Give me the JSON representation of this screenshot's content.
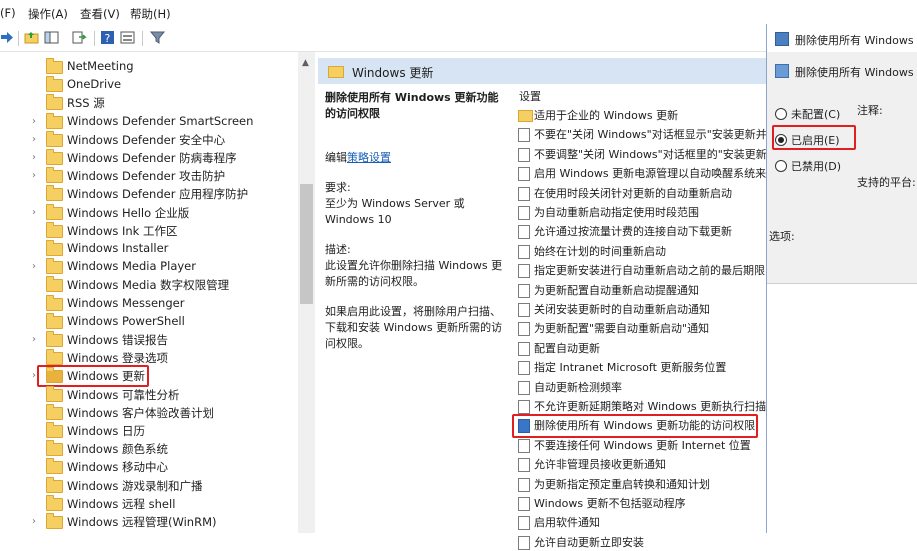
{
  "menubar": {
    "file_fragment": "(F)",
    "action": "操作(A)",
    "view": "查看(V)",
    "help": "帮助(H)"
  },
  "tree": {
    "items": [
      {
        "label": "NetMeeting",
        "expandable": false
      },
      {
        "label": "OneDrive",
        "expandable": false
      },
      {
        "label": "RSS 源",
        "expandable": false
      },
      {
        "label": "Windows Defender SmartScreen",
        "expandable": true
      },
      {
        "label": "Windows Defender 安全中心",
        "expandable": true
      },
      {
        "label": "Windows Defender 防病毒程序",
        "expandable": true
      },
      {
        "label": "Windows Defender 攻击防护",
        "expandable": true
      },
      {
        "label": "Windows Defender 应用程序防护",
        "expandable": false
      },
      {
        "label": "Windows Hello 企业版",
        "expandable": true
      },
      {
        "label": "Windows Ink 工作区",
        "expandable": false
      },
      {
        "label": "Windows Installer",
        "expandable": false
      },
      {
        "label": "Windows Media Player",
        "expandable": true
      },
      {
        "label": "Windows Media 数字权限管理",
        "expandable": false
      },
      {
        "label": "Windows Messenger",
        "expandable": false
      },
      {
        "label": "Windows PowerShell",
        "expandable": false
      },
      {
        "label": "Windows 错误报告",
        "expandable": true
      },
      {
        "label": "Windows 登录选项",
        "expandable": false
      },
      {
        "label": "Windows 更新",
        "expandable": true,
        "selected": true
      },
      {
        "label": "Windows 可靠性分析",
        "expandable": false
      },
      {
        "label": "Windows 客户体验改善计划",
        "expandable": false
      },
      {
        "label": "Windows 日历",
        "expandable": false
      },
      {
        "label": "Windows 颜色系统",
        "expandable": false
      },
      {
        "label": "Windows 移动中心",
        "expandable": false
      },
      {
        "label": "Windows 游戏录制和广播",
        "expandable": false
      },
      {
        "label": "Windows 远程 shell",
        "expandable": false
      },
      {
        "label": "Windows 远程管理(WinRM)",
        "expandable": true
      }
    ]
  },
  "detail": {
    "header": "Windows 更新",
    "policy_title": "删除使用所有 Windows 更新功能的访问权限",
    "edit_prefix": "编辑",
    "edit_link": "策略设置",
    "req_label": "要求:",
    "req_text": "至少为 Windows Server 或 Windows 10",
    "desc_label": "描述:",
    "desc_text": "此设置允许你删除扫描 Windows 更新所需的访问权限。",
    "desc_more": "如果启用此设置，将删除用户扫描、下载和安装 Windows 更新所需的访问权限。"
  },
  "settings": {
    "header": "设置",
    "items": [
      {
        "label": "适用于企业的 Windows 更新",
        "icon": "folder"
      },
      {
        "label": "不要在\"关闭 Windows\"对话框显示\"安装更新并关机\"",
        "icon": "policy"
      },
      {
        "label": "不要调整\"关闭 Windows\"对话框里的\"安装更新并关机\"",
        "icon": "policy"
      },
      {
        "label": "启用 Windows 更新电源管理以自动唤醒系统来安装计划的更新",
        "icon": "policy"
      },
      {
        "label": "在使用时段关闭针对更新的自动重新启动",
        "icon": "policy"
      },
      {
        "label": "为自动重新启动指定使用时段范围",
        "icon": "policy"
      },
      {
        "label": "允许通过按流量计费的连接自动下载更新",
        "icon": "policy"
      },
      {
        "label": "始终在计划的时间重新启动",
        "icon": "policy"
      },
      {
        "label": "指定更新安装进行自动重新启动之前的最后期限",
        "icon": "policy"
      },
      {
        "label": "为更新配置自动重新启动提醒通知",
        "icon": "policy"
      },
      {
        "label": "关闭安装更新时的自动重新启动通知",
        "icon": "policy"
      },
      {
        "label": "为更新配置\"需要自动重新启动\"通知",
        "icon": "policy"
      },
      {
        "label": "配置自动更新",
        "icon": "policy"
      },
      {
        "label": "指定 Intranet Microsoft 更新服务位置",
        "icon": "policy"
      },
      {
        "label": "自动更新检测频率",
        "icon": "policy"
      },
      {
        "label": "不允许更新延期策略对 Windows 更新执行扫描",
        "icon": "policy"
      },
      {
        "label": "删除使用所有 Windows 更新功能的访问权限",
        "icon": "policy",
        "selected": true
      },
      {
        "label": "不要连接任何 Windows 更新 Internet 位置",
        "icon": "policy"
      },
      {
        "label": "允许非管理员接收更新通知",
        "icon": "policy"
      },
      {
        "label": "为更新指定预定重启转换和通知计划",
        "icon": "policy"
      },
      {
        "label": "Windows 更新不包括驱动程序",
        "icon": "policy"
      },
      {
        "label": "启用软件通知",
        "icon": "policy"
      },
      {
        "label": "允许自动更新立即安装",
        "icon": "policy"
      }
    ]
  },
  "dialog": {
    "title": "删除使用所有 Windows 更新",
    "subtitle": "删除使用所有 Windows",
    "radio_not_configured": "未配置(C)",
    "radio_enabled": "已启用(E)",
    "radio_disabled": "已禁用(D)",
    "comment_label": "注释:",
    "platform_label": "支持的平台:",
    "options_label": "选项:"
  },
  "colors": {
    "highlight": "#e02020",
    "header_bg": "#d6e4f3"
  }
}
